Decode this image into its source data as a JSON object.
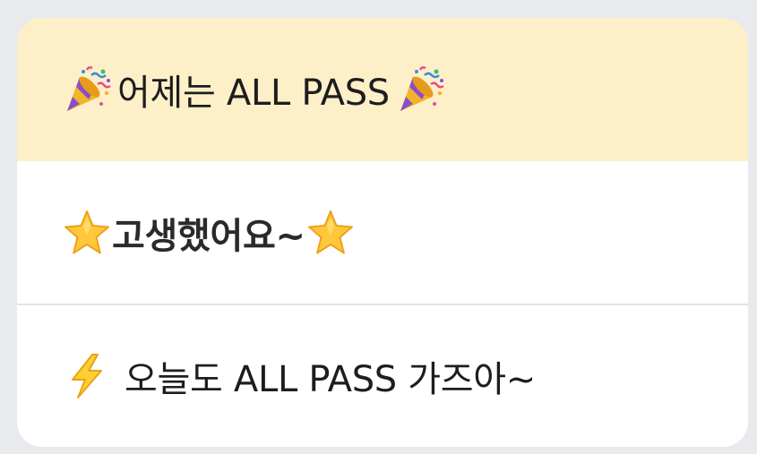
{
  "messages": [
    {
      "text": "어제는 ALL PASS",
      "leading_icon": "party-popper-icon",
      "trailing_icon": "party-popper-icon"
    },
    {
      "text": "고생했어요~",
      "leading_icon": "star-icon",
      "trailing_icon": "star-icon"
    },
    {
      "text": "오늘도 ALL PASS 가즈아~",
      "leading_icon": "lightning-bolt-icon"
    }
  ],
  "colors": {
    "background": "#e9eaee",
    "highlight_row": "#fdf0c8",
    "card": "#ffffff",
    "text": "#1d1d1f"
  }
}
